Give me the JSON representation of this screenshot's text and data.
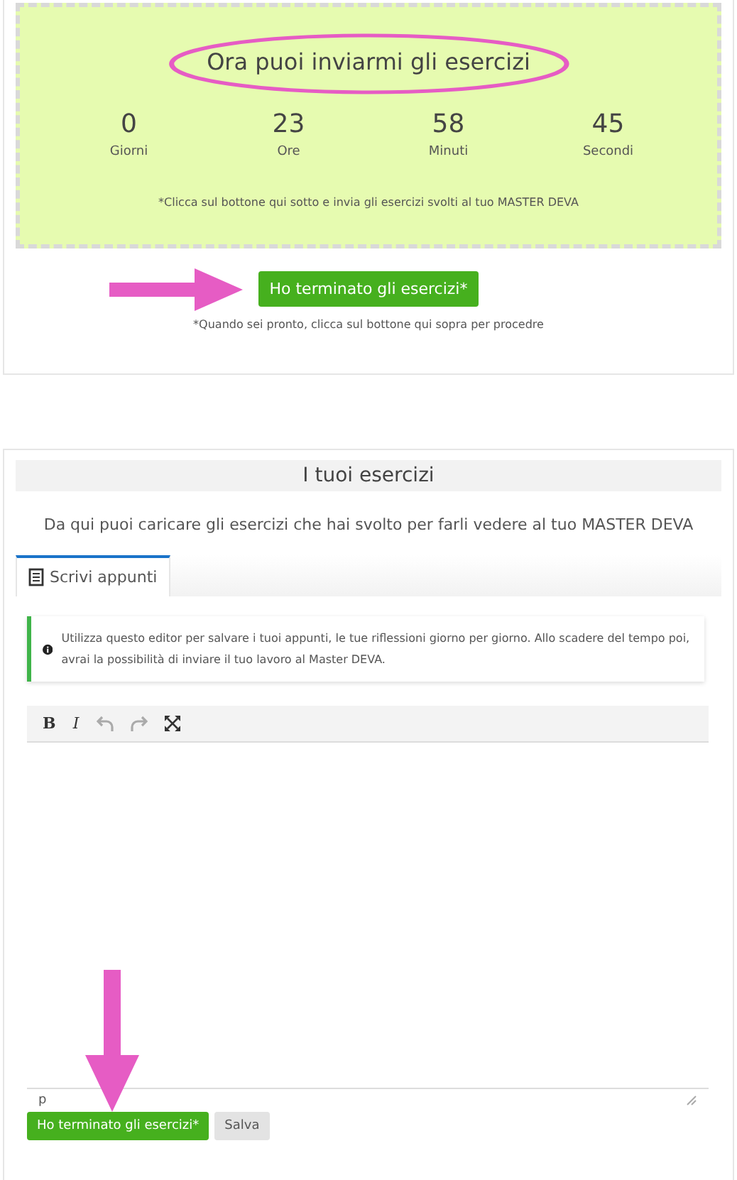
{
  "countdown": {
    "title": "Ora puoi inviarmi gli esercizi",
    "units": [
      {
        "value": "0",
        "label": "Giorni"
      },
      {
        "value": "23",
        "label": "Ore"
      },
      {
        "value": "58",
        "label": "Minuti"
      },
      {
        "value": "45",
        "label": "Secondi"
      }
    ],
    "note": "*Clicca sul bottone qui sotto e invia gli esercizi svolti al tuo MASTER DEVA",
    "button": "Ho terminato gli esercizi*",
    "hint": "*Quando sei pronto, clicca sul bottone qui sopra per procedre"
  },
  "exercises": {
    "heading": "I tuoi esercizi",
    "subtitle": "Da qui puoi caricare gli esercizi che hai svolto per farli vedere al tuo MASTER DEVA",
    "tabs": [
      {
        "label": "Scrivi appunti",
        "selected": true
      }
    ],
    "info": "Utilizza questo editor per salvare i tuoi appunti, le tue riflessioni giorno per giorno. Allo scadere del tempo poi, avrai la possibilità di inviare il tuo lavoro al Master DEVA.",
    "toolbar": [
      {
        "kind": "bold",
        "label": "B"
      },
      {
        "kind": "italic",
        "label": "I"
      },
      {
        "kind": "undo",
        "disabled": true
      },
      {
        "kind": "redo",
        "disabled": true
      },
      {
        "kind": "fullscreen"
      }
    ],
    "status_path": "p",
    "buttons": [
      {
        "kind": "primary",
        "label": "Ho terminato gli esercizi*"
      },
      {
        "kind": "secondary",
        "label": "Salva"
      }
    ]
  }
}
